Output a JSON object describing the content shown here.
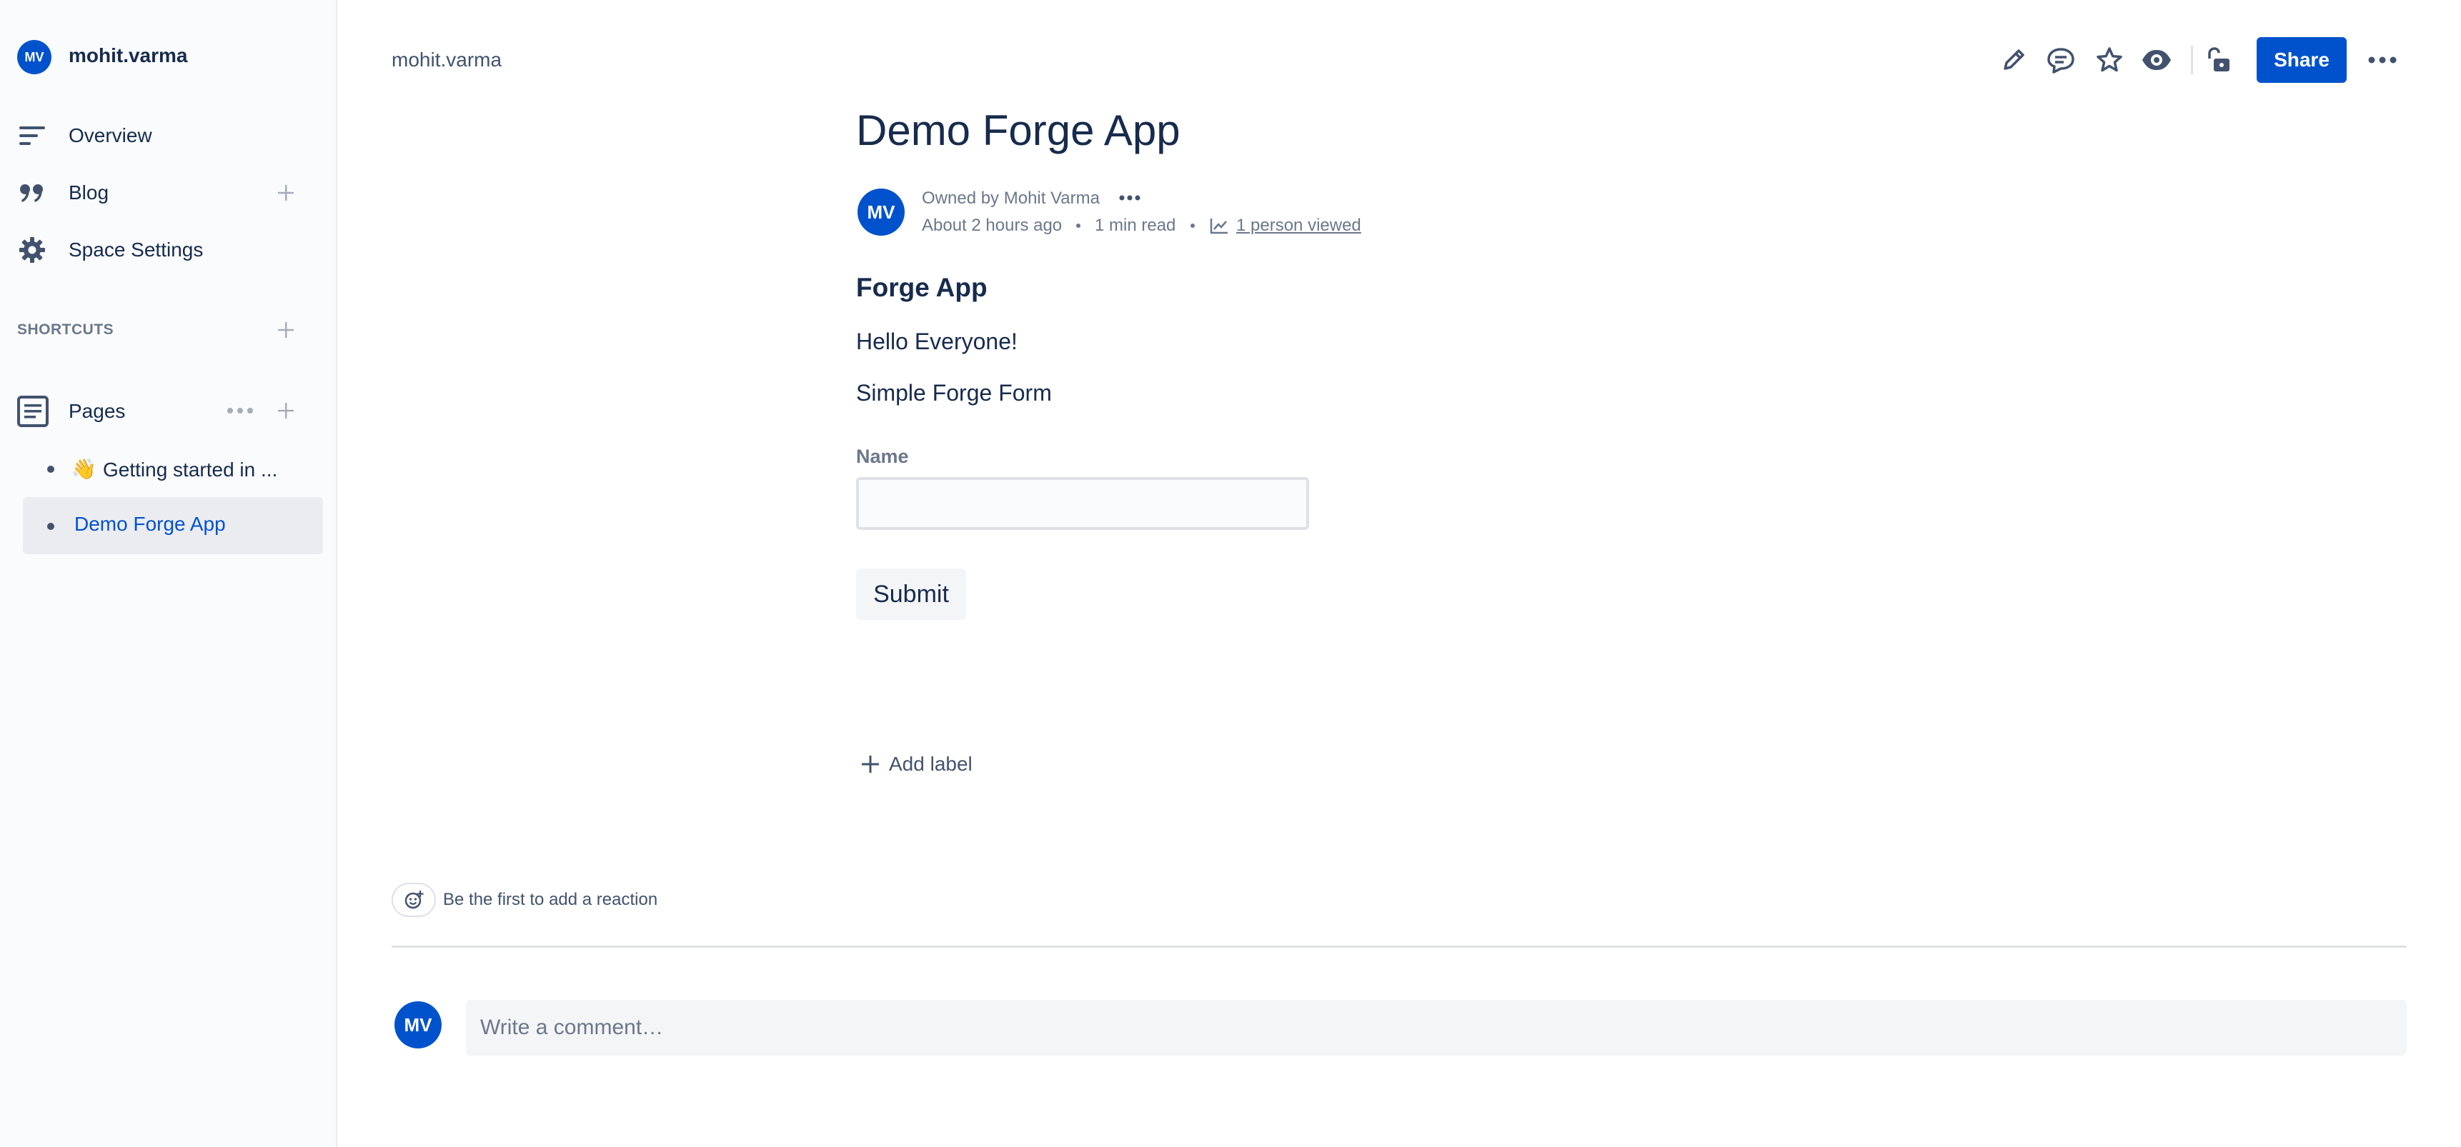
{
  "sidebar": {
    "space": {
      "avatar_initials": "MV",
      "name": "mohit.varma"
    },
    "nav": [
      {
        "label": "Overview",
        "icon": "overview-lines-icon"
      },
      {
        "label": "Blog",
        "icon": "quote-icon"
      },
      {
        "label": "Space Settings",
        "icon": "gear-icon"
      }
    ],
    "shortcuts_heading": "SHORTCUTS",
    "pages_label": "Pages",
    "page_tree": [
      {
        "emoji": "👋",
        "label": "Getting started in ..."
      },
      {
        "label": "Demo Forge App",
        "selected": true
      }
    ]
  },
  "breadcrumb": "mohit.varma",
  "toolbar": {
    "share_label": "Share"
  },
  "page": {
    "title": "Demo Forge App",
    "byline": {
      "avatar_initials": "MV",
      "owned_by": "Owned by Mohit Varma",
      "time": "About 2 hours ago",
      "read_time": "1 min read",
      "views": "1 person viewed"
    },
    "content": {
      "heading": "Forge App",
      "greeting": "Hello Everyone!",
      "form_title": "Simple Forge Form",
      "field_label": "Name",
      "field_value": "",
      "submit_label": "Submit"
    },
    "add_label": "Add label",
    "reaction_prompt": "Be the first to add a reaction",
    "comment": {
      "avatar_initials": "MV",
      "placeholder": "Write a comment…"
    }
  },
  "colors": {
    "brand": "#0052cc",
    "text": "#172b4d",
    "muted": "#6b778c",
    "sidebar_bg": "#fafbfc",
    "selected_bg": "#ebecf0"
  }
}
